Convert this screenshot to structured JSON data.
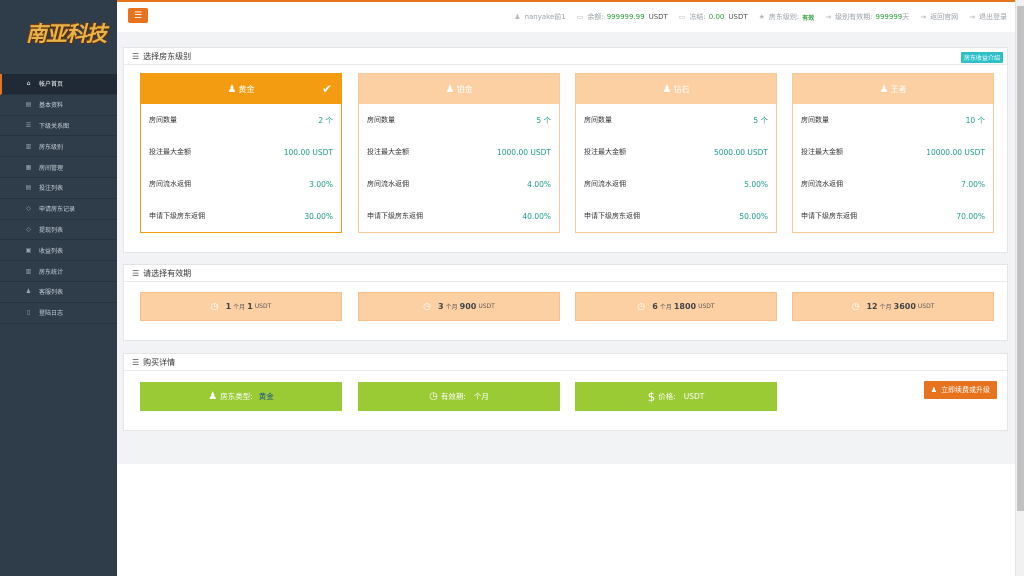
{
  "logo": {
    "text": "南亚科技"
  },
  "sidebar": {
    "items": [
      {
        "label": "帐户首页",
        "icon": "home-icon",
        "glyph": "⌂",
        "active": true
      },
      {
        "label": "基本资料",
        "icon": "id-card-icon",
        "glyph": "▤"
      },
      {
        "label": "下级关系图",
        "icon": "list-icon",
        "glyph": "☰"
      },
      {
        "label": "房东级别",
        "icon": "bank-icon",
        "glyph": "▥"
      },
      {
        "label": "房间管理",
        "icon": "building-icon",
        "glyph": "▦"
      },
      {
        "label": "投注列表",
        "icon": "table-icon",
        "glyph": "▤"
      },
      {
        "label": "申请房东记录",
        "icon": "diamond-icon",
        "glyph": "◇"
      },
      {
        "label": "提现列表",
        "icon": "diamond-icon",
        "glyph": "◇"
      },
      {
        "label": "收益列表",
        "icon": "calendar-icon",
        "glyph": "▣"
      },
      {
        "label": "房东统计",
        "icon": "chart-icon",
        "glyph": "▥"
      },
      {
        "label": "客服列表",
        "icon": "users-icon",
        "glyph": "♟"
      },
      {
        "label": "登陆日志",
        "icon": "file-icon",
        "glyph": "▯"
      }
    ]
  },
  "topbar": {
    "username": "nanyake前1",
    "balance_label": "余额:",
    "balance_value": "999999.99",
    "balance_unit": "USDT",
    "frozen_label": "冻结:",
    "frozen_value": "0.00",
    "frozen_unit": "USDT",
    "level_label": "房东级别:",
    "level_value": "有效",
    "validity_label": "级别有效期:",
    "validity_value": "999999",
    "validity_unit": "天",
    "home_link": "返回官网",
    "logout_link": "退出登录"
  },
  "section_level": {
    "title": "选择房东级别",
    "intro_badge": "房东收益介绍",
    "row_labels": {
      "rooms": "房间数量",
      "max_bet": "投注最大金额",
      "commission": "房间流水返佣",
      "sub_commission": "申请下级房东返佣"
    },
    "cards": [
      {
        "name": "黄金",
        "rooms": "2 个",
        "max_bet": "100.00 USDT",
        "commission": "3.00%",
        "sub_commission": "30.00%",
        "selected": true
      },
      {
        "name": "铂金",
        "rooms": "5 个",
        "max_bet": "1000.00 USDT",
        "commission": "4.00%",
        "sub_commission": "40.00%",
        "selected": false
      },
      {
        "name": "钻石",
        "rooms": "5 个",
        "max_bet": "5000.00 USDT",
        "commission": "5.00%",
        "sub_commission": "50.00%",
        "selected": false
      },
      {
        "name": "王者",
        "rooms": "10 个",
        "max_bet": "10000.00 USDT",
        "commission": "7.00%",
        "sub_commission": "70.00%",
        "selected": false
      }
    ]
  },
  "section_duration": {
    "title": "请选择有效期",
    "options": [
      {
        "months": "1",
        "month_unit": "个月",
        "price": "1",
        "currency": "USDT"
      },
      {
        "months": "3",
        "month_unit": "个月",
        "price": "900",
        "currency": "USDT"
      },
      {
        "months": "6",
        "month_unit": "个月",
        "price": "1800",
        "currency": "USDT"
      },
      {
        "months": "12",
        "month_unit": "个月",
        "price": "3600",
        "currency": "USDT"
      }
    ]
  },
  "section_purchase": {
    "title": "购买详情",
    "type_label": "房东类型:",
    "type_value": "黄金",
    "validity_label": "有效期:",
    "validity_value": "个月",
    "price_label": "价格:",
    "price_value": "USDT",
    "upgrade_button": "立即续费或升级"
  },
  "colors": {
    "accent": "#e8731f",
    "sidebar": "#2f3d4b",
    "selected_card": "#f39c12",
    "card_header": "#fdd0a3",
    "green": "#9acb35",
    "teal_value": "#1e9a8a",
    "badge": "#2ec0c8"
  }
}
